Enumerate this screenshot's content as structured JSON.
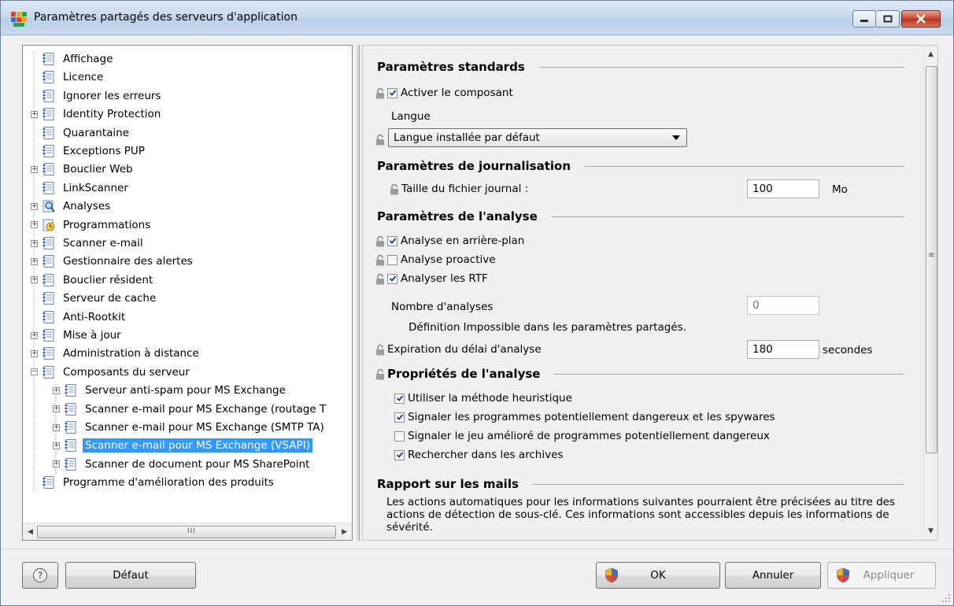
{
  "window": {
    "title": "Paramètres partagés des serveurs d'application",
    "icons": {
      "app": "avg-logo-icon",
      "minimize": "minimize-icon",
      "maximize": "maximize-icon",
      "close": "close-icon"
    }
  },
  "tree": {
    "items": [
      {
        "label": "Affichage",
        "level": 0,
        "expandable": false,
        "icon": "document-icon"
      },
      {
        "label": "Licence",
        "level": 0,
        "expandable": false,
        "icon": "document-icon"
      },
      {
        "label": "Ignorer les erreurs",
        "level": 0,
        "expandable": false,
        "icon": "document-icon"
      },
      {
        "label": "Identity Protection",
        "level": 0,
        "expandable": true,
        "expanded": false,
        "icon": "document-icon"
      },
      {
        "label": "Quarantaine",
        "level": 0,
        "expandable": false,
        "icon": "document-icon"
      },
      {
        "label": "Exceptions PUP",
        "level": 0,
        "expandable": false,
        "icon": "document-icon"
      },
      {
        "label": "Bouclier Web",
        "level": 0,
        "expandable": true,
        "expanded": false,
        "icon": "document-icon"
      },
      {
        "label": "LinkScanner",
        "level": 0,
        "expandable": false,
        "icon": "document-icon"
      },
      {
        "label": "Analyses",
        "level": 0,
        "expandable": true,
        "expanded": false,
        "icon": "magnifier-icon"
      },
      {
        "label": "Programmations",
        "level": 0,
        "expandable": true,
        "expanded": false,
        "icon": "schedule-icon"
      },
      {
        "label": "Scanner e-mail",
        "level": 0,
        "expandable": true,
        "expanded": false,
        "icon": "document-icon"
      },
      {
        "label": "Gestionnaire des alertes",
        "level": 0,
        "expandable": true,
        "expanded": false,
        "icon": "document-icon"
      },
      {
        "label": "Bouclier résident",
        "level": 0,
        "expandable": true,
        "expanded": false,
        "icon": "document-icon"
      },
      {
        "label": "Serveur de cache",
        "level": 0,
        "expandable": false,
        "icon": "document-icon"
      },
      {
        "label": "Anti-Rootkit",
        "level": 0,
        "expandable": false,
        "icon": "document-icon"
      },
      {
        "label": "Mise à jour",
        "level": 0,
        "expandable": true,
        "expanded": false,
        "icon": "document-icon"
      },
      {
        "label": "Administration à distance",
        "level": 0,
        "expandable": true,
        "expanded": false,
        "icon": "document-icon"
      },
      {
        "label": "Composants du serveur",
        "level": 0,
        "expandable": true,
        "expanded": true,
        "icon": "document-icon"
      },
      {
        "label": "Serveur anti-spam pour MS Exchange",
        "level": 1,
        "expandable": true,
        "expanded": false,
        "icon": "document-icon"
      },
      {
        "label": "Scanner e-mail pour MS Exchange (routage T",
        "level": 1,
        "expandable": true,
        "expanded": false,
        "icon": "document-icon"
      },
      {
        "label": "Scanner e-mail pour MS Exchange (SMTP TA)",
        "level": 1,
        "expandable": true,
        "expanded": false,
        "icon": "document-icon"
      },
      {
        "label": "Scanner e-mail pour MS Exchange (VSAPI)",
        "level": 1,
        "expandable": true,
        "expanded": false,
        "icon": "document-icon",
        "selected": true
      },
      {
        "label": "Scanner de document pour MS SharePoint",
        "level": 1,
        "expandable": true,
        "expanded": false,
        "icon": "document-icon"
      },
      {
        "label": "Programme d'amélioration des produits",
        "level": 0,
        "expandable": false,
        "icon": "document-icon"
      }
    ],
    "scroll_grip": "III"
  },
  "settings": {
    "standard": {
      "heading": "Paramètres standards",
      "enable_component": {
        "label": "Activer le composant",
        "checked": true
      },
      "language_label": "Langue",
      "language_value": "Langue installée par défaut"
    },
    "logging": {
      "heading": "Paramètres de journalisation",
      "log_size_label": "Taille du fichier journal :",
      "log_size_value": "100",
      "log_size_unit": "Mo"
    },
    "scan": {
      "heading": "Paramètres de l'analyse",
      "background": {
        "label": "Analyse en arrière-plan",
        "checked": true
      },
      "proactive": {
        "label": "Analyse proactive",
        "checked": false
      },
      "rtf": {
        "label": "Analyser les RTF",
        "checked": true
      },
      "count_label": "Nombre d'analyses",
      "count_value": "0",
      "count_note": "Définition Impossible dans les paramètres partagés.",
      "timeout_label": "Expiration du délai d'analyse",
      "timeout_value": "180",
      "timeout_unit": "secondes"
    },
    "properties": {
      "heading": "Propriétés de l'analyse",
      "heuristic": {
        "label": "Utiliser la méthode heuristique",
        "checked": true
      },
      "pup_spyware": {
        "label": "Signaler les programmes potentiellement dangereux et les spywares",
        "checked": true
      },
      "enhanced_pup": {
        "label": "Signaler le jeu amélioré de programmes potentiellement dangereux",
        "checked": false
      },
      "archives": {
        "label": "Rechercher dans les archives",
        "checked": true
      }
    },
    "report": {
      "heading": "Rapport sur les mails",
      "text": "Les actions automatiques pour les informations suivantes pourraient être précisées au titre des actions de détection de sous-clé. Ces informations sont accessibles depuis les informations de sévérité."
    }
  },
  "buttons": {
    "help": "?",
    "default": "Défaut",
    "ok": "OK",
    "cancel": "Annuler",
    "apply": "Appliquer"
  },
  "colors": {
    "selection": "#3399ff",
    "title_bar": "#c9daef",
    "close_button": "#c8452b"
  }
}
